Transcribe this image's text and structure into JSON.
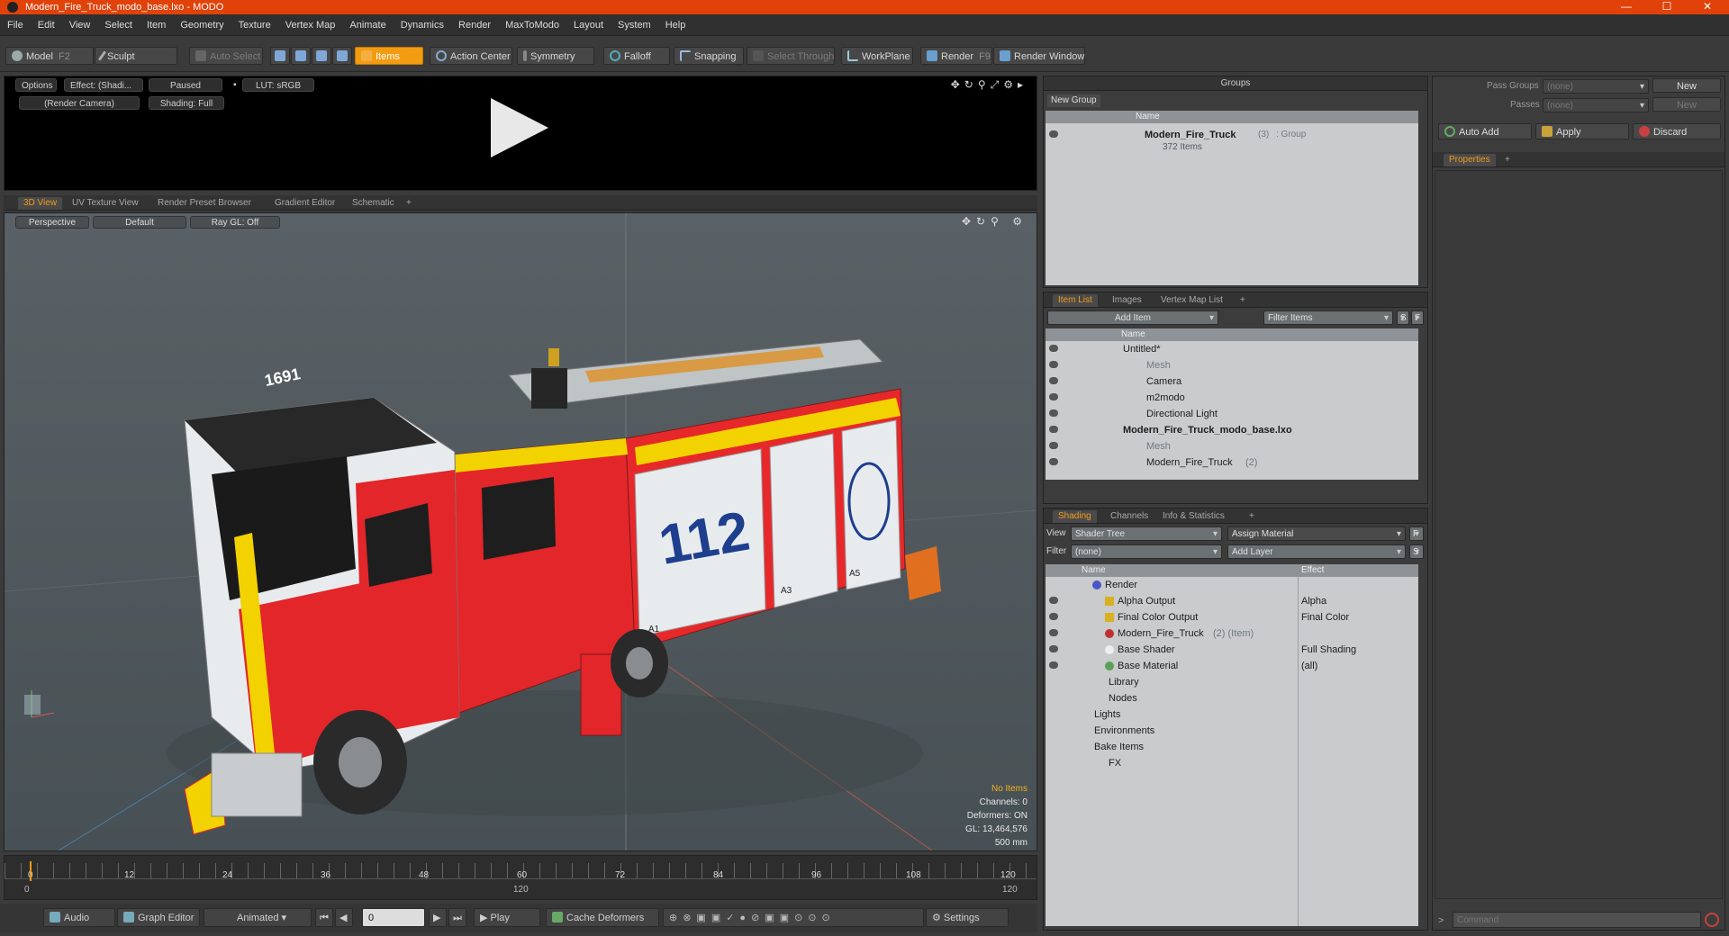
{
  "window": {
    "title": "Modern_Fire_Truck_modo_base.lxo - MODO",
    "minimize": "—",
    "maximize": "☐",
    "close": "✕"
  },
  "menu": [
    "File",
    "Edit",
    "View",
    "Select",
    "Item",
    "Geometry",
    "Texture",
    "Vertex Map",
    "Animate",
    "Dynamics",
    "Render",
    "MaxToModo",
    "Layout",
    "System",
    "Help"
  ],
  "toolbar": {
    "model": "Model",
    "model_key": "F2",
    "sculpt": "Sculpt",
    "auto_select": "Auto Select",
    "items": "Items",
    "action_center": "Action Center",
    "symmetry": "Symmetry",
    "falloff": "Falloff",
    "snapping": "Snapping",
    "select_through": "Select Through",
    "workplane": "WorkPlane",
    "render": "Render",
    "render_key": "F9",
    "render_window": "Render Window"
  },
  "preview": {
    "options": "Options",
    "effect": "Effect: (Shadi...",
    "paused": "Paused",
    "lut": "LUT: sRGB",
    "camera": "(Render Camera)",
    "shading": "Shading: Full"
  },
  "viewport_tabs": [
    "3D View",
    "UV Texture View",
    "Render Preset Browser",
    "Gradient Editor",
    "Schematic",
    "+"
  ],
  "viewport": {
    "perspective": "Perspective",
    "default": "Default",
    "raygl": "Ray GL: Off",
    "stats": {
      "no_items": "No Items",
      "channels": "Channels: 0",
      "deformers": "Deformers: ON",
      "gl": "GL: 13,464,576",
      "scale": "500 mm"
    },
    "truck_number": "112",
    "cab_number": "1691",
    "door_label_a1": "A1",
    "door_label_a3": "A3",
    "door_label_a5": "A5"
  },
  "timeline": {
    "ticks": [
      "0",
      "12",
      "24",
      "36",
      "48",
      "60",
      "72",
      "84",
      "96",
      "108",
      "120"
    ],
    "mid_label": "120",
    "end_label": "120",
    "start_label": "0"
  },
  "bottombar": {
    "audio": "Audio",
    "graph_editor": "Graph Editor",
    "animated": "Animated",
    "frame": "0",
    "play": "Play",
    "cache": "Cache Deformers",
    "settings": "Settings"
  },
  "groups": {
    "title": "Groups",
    "new_group": "New Group",
    "col_name": "Name",
    "item_name": "Modern_Fire_Truck",
    "item_count": "(3)",
    "item_type": ": Group",
    "item_sub": "372 Items"
  },
  "item_list": {
    "tabs": [
      "Item List",
      "Images",
      "Vertex Map List",
      "+"
    ],
    "add_item": "Add Item",
    "filter": "Filter Items",
    "s_btn": "S",
    "f_btn": "F",
    "col_name": "Name",
    "rows": [
      {
        "label": "Untitled*",
        "grey": ""
      },
      {
        "label": "Mesh",
        "grey": ""
      },
      {
        "label": "Camera",
        "grey": ""
      },
      {
        "label": "m2modo",
        "grey": ""
      },
      {
        "label": "Directional Light",
        "grey": ""
      },
      {
        "label": "Modern_Fire_Truck_modo_base.lxo",
        "grey": ""
      },
      {
        "label": "Mesh",
        "grey": ""
      },
      {
        "label": "Modern_Fire_Truck",
        "grey": "(2)"
      }
    ]
  },
  "shading": {
    "tabs": [
      "Shading",
      "Channels",
      "Info & Statistics",
      "+"
    ],
    "view_label": "View",
    "view_value": "Shader Tree",
    "assign": "Assign Material",
    "f_btn": "F",
    "filter_label": "Filter",
    "filter_value": "(none)",
    "add_layer": "Add Layer",
    "s_btn": "S",
    "col_name": "Name",
    "col_effect": "Effect",
    "rows": [
      {
        "name": "Render",
        "extra": "",
        "effect": ""
      },
      {
        "name": "Alpha Output",
        "extra": "",
        "effect": "Alpha"
      },
      {
        "name": "Final Color Output",
        "extra": "",
        "effect": "Final Color"
      },
      {
        "name": "Modern_Fire_Truck",
        "extra": "(2) (Item)",
        "effect": ""
      },
      {
        "name": "Base Shader",
        "extra": "",
        "effect": "Full Shading"
      },
      {
        "name": "Base Material",
        "extra": "",
        "effect": "(all)"
      },
      {
        "name": "Library",
        "extra": "",
        "effect": ""
      },
      {
        "name": "Nodes",
        "extra": "",
        "effect": ""
      },
      {
        "name": "Lights",
        "extra": "",
        "effect": ""
      },
      {
        "name": "Environments",
        "extra": "",
        "effect": ""
      },
      {
        "name": "Bake Items",
        "extra": "",
        "effect": ""
      },
      {
        "name": "FX",
        "extra": "",
        "effect": ""
      }
    ]
  },
  "pass": {
    "pass_groups": "Pass Groups",
    "passes": "Passes",
    "none": "(none)",
    "new": "New",
    "auto_add": "Auto Add",
    "apply": "Apply",
    "discard": "Discard",
    "properties": "Properties",
    "plus": "+"
  },
  "command": {
    "placeholder": "Command",
    "prompt": ">"
  }
}
